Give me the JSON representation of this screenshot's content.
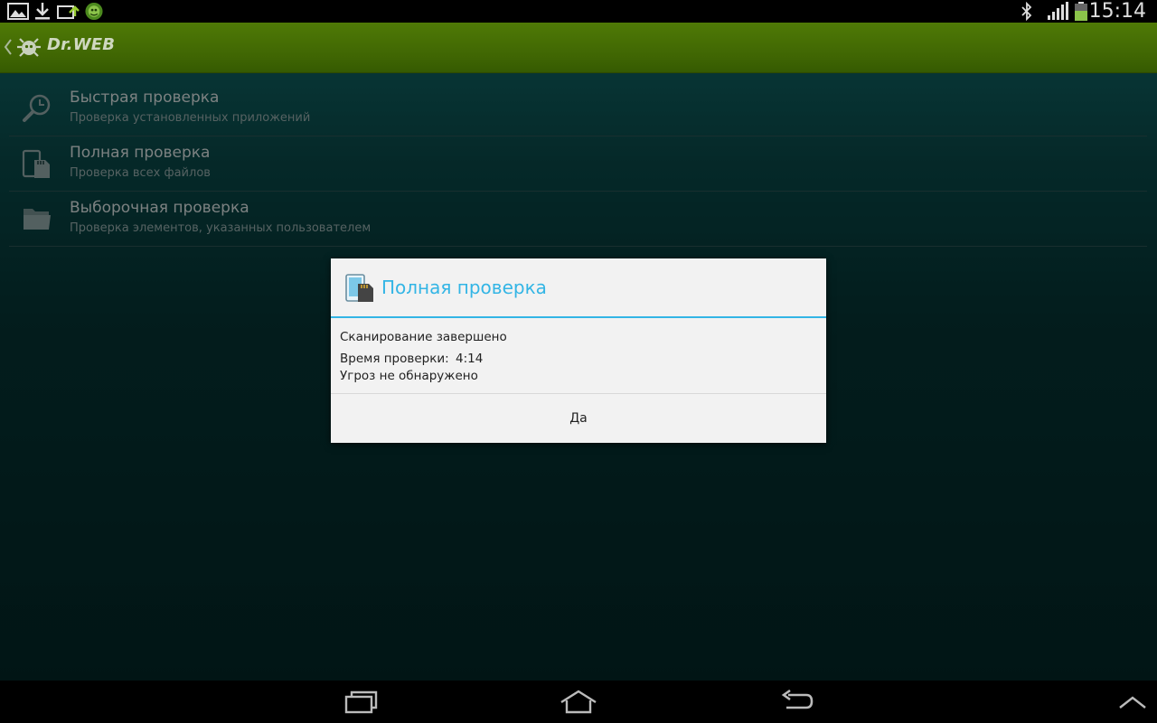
{
  "status_bar": {
    "time": "15:14",
    "icons": [
      "gallery-icon",
      "download-icon",
      "sync-icon",
      "drweb-icon",
      "bluetooth-icon",
      "signal-icon",
      "battery-icon"
    ]
  },
  "action_bar": {
    "brand": "Dr.WEB"
  },
  "menu": {
    "items": [
      {
        "title": "Быстрая проверка",
        "subtitle": "Проверка установленных приложений",
        "icon": "magnifier-clock-icon"
      },
      {
        "title": "Полная проверка",
        "subtitle": "Проверка всех файлов",
        "icon": "device-sdcard-icon"
      },
      {
        "title": "Выборочная проверка",
        "subtitle": "Проверка элементов, указанных пользователем",
        "icon": "folder-icon"
      }
    ]
  },
  "dialog": {
    "title": "Полная проверка",
    "status": "Сканирование завершено",
    "time_label": "Время проверки:",
    "time_value": "4:14",
    "threats": "Угроз не обнаружено",
    "ok_label": "Да"
  },
  "colors": {
    "accent": "#33b5e5",
    "action_bar": "#3f6503",
    "background": "#053131"
  },
  "nav_bar": {
    "buttons": [
      "recent-apps-icon",
      "home-icon",
      "back-icon",
      "expand-up-icon"
    ]
  }
}
